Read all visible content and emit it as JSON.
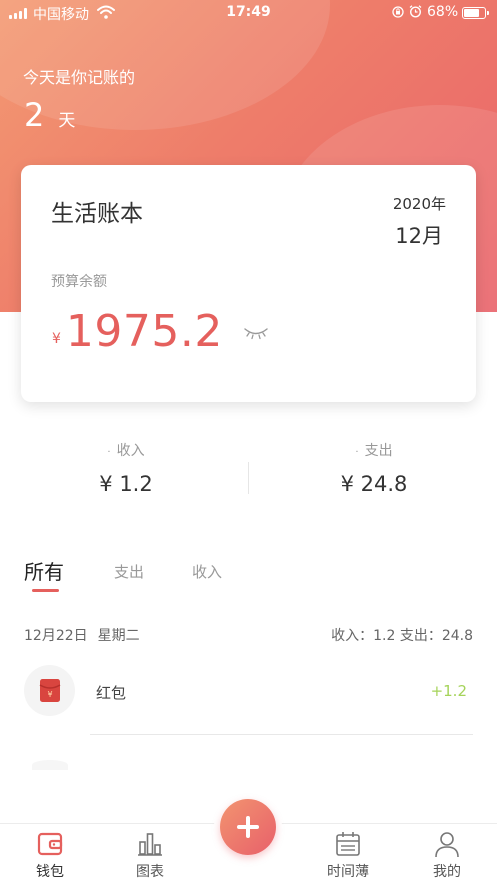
{
  "status_bar": {
    "carrier": "中国移动",
    "time": "17:49",
    "battery": "68%",
    "battery_level": 0.68
  },
  "header": {
    "streak_label": "今天是你记账的",
    "streak_days": "2",
    "streak_unit": "天"
  },
  "card": {
    "title": "生活账本",
    "year": "2020年",
    "month": "12月",
    "budget_label": "预算余额",
    "currency": "¥",
    "budget_amount": "1975.2"
  },
  "summary": {
    "income_label": "收入",
    "income_value": "¥ 1.2",
    "expense_label": "支出",
    "expense_value": "¥ 24.8",
    "bullet": "·"
  },
  "tabs": {
    "all": "所有",
    "expense": "支出",
    "income": "收入",
    "active": "all"
  },
  "day_group": {
    "date": "12月22日",
    "weekday": "星期二",
    "totals": "收入：1.2  支出：24.8"
  },
  "transactions": [
    {
      "name": "红包",
      "amount": "+1.2",
      "icon": "red-envelope-icon"
    }
  ],
  "tabbar": {
    "wallet": "钱包",
    "chart": "图表",
    "timeline": "时间薄",
    "mine": "我的",
    "active": "wallet"
  },
  "colors": {
    "accent": "#e5605d",
    "header_start": "#f39a72",
    "header_end": "#e9636a",
    "income_green": "#a5d35a"
  }
}
